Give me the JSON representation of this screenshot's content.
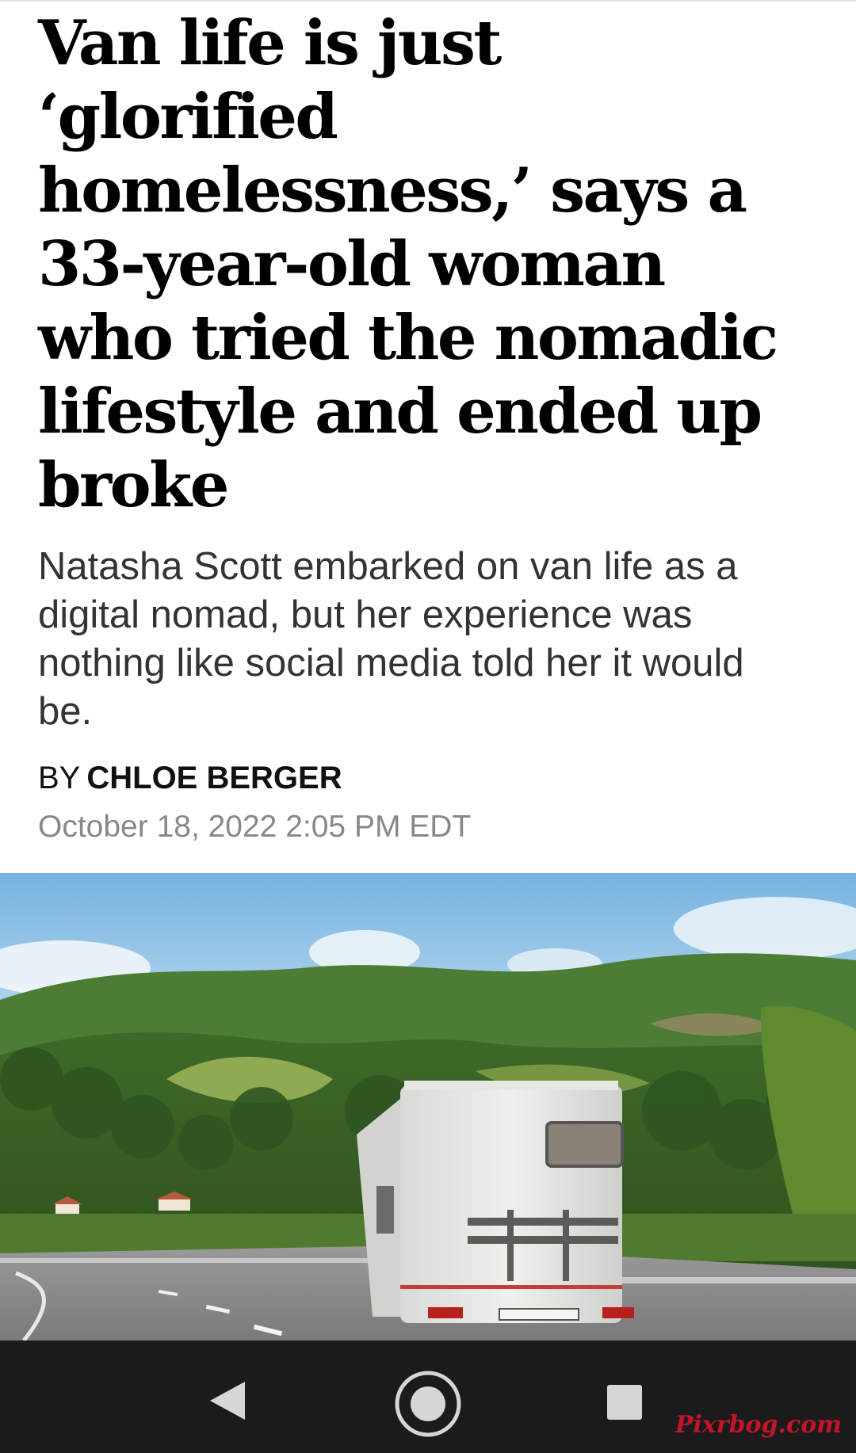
{
  "article": {
    "headline_lines": [
      "Van life is just",
      "‘glorified",
      "homelessness,’ says a",
      "33-year-old woman",
      "who tried the nomadic",
      "lifestyle and ended up",
      "broke"
    ],
    "dek_lines": [
      "Natasha Scott embarked on van life as a",
      "digital nomad, but her experience was",
      "nothing like social media told her it would",
      "be."
    ],
    "byline_prefix": "BY",
    "author": "CHLOE BERGER",
    "timestamp": "October 18, 2022 2:05 PM EDT"
  },
  "hero_image": {
    "description_icon": "camper-van-on-road-photo"
  },
  "navbar": {
    "buttons": [
      "back-icon",
      "home-icon",
      "recents-icon"
    ]
  },
  "watermark": "Pixrbog.com",
  "colors": {
    "text": "#000000",
    "dek": "#333333",
    "timestamp": "#888888",
    "navbar": "#1b1b1b",
    "watermark": "#c4142a"
  }
}
